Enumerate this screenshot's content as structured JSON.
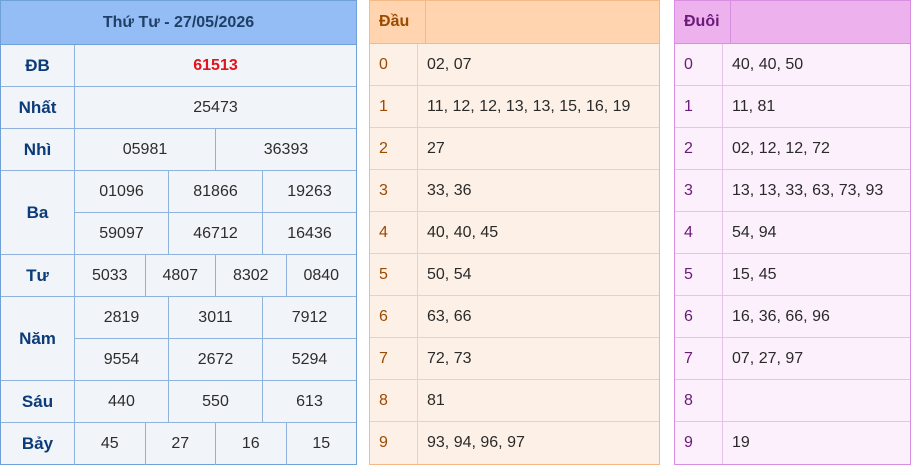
{
  "results": {
    "title": "Thứ Tư - 27/05/2026",
    "prizes": [
      {
        "name": "ĐB",
        "rows": [
          [
            "61513"
          ]
        ],
        "special": true
      },
      {
        "name": "Nhất",
        "rows": [
          [
            "25473"
          ]
        ]
      },
      {
        "name": "Nhì",
        "rows": [
          [
            "05981",
            "36393"
          ]
        ]
      },
      {
        "name": "Ba",
        "rows": [
          [
            "01096",
            "81866",
            "19263"
          ],
          [
            "59097",
            "46712",
            "16436"
          ]
        ]
      },
      {
        "name": "Tư",
        "rows": [
          [
            "5033",
            "4807",
            "8302",
            "0840"
          ]
        ]
      },
      {
        "name": "Năm",
        "rows": [
          [
            "2819",
            "3011",
            "7912"
          ],
          [
            "9554",
            "2672",
            "5294"
          ]
        ]
      },
      {
        "name": "Sáu",
        "rows": [
          [
            "440",
            "550",
            "613"
          ]
        ]
      },
      {
        "name": "Bảy",
        "rows": [
          [
            "45",
            "27",
            "16",
            "15"
          ]
        ]
      }
    ]
  },
  "dau": {
    "header": "Đầu",
    "rows": [
      {
        "key": "0",
        "value": "02, 07"
      },
      {
        "key": "1",
        "value": "11, 12, 12, 13, 13, 15, 16, 19"
      },
      {
        "key": "2",
        "value": "27"
      },
      {
        "key": "3",
        "value": "33, 36"
      },
      {
        "key": "4",
        "value": "40, 40, 45"
      },
      {
        "key": "5",
        "value": "50, 54"
      },
      {
        "key": "6",
        "value": "63, 66"
      },
      {
        "key": "7",
        "value": "72, 73"
      },
      {
        "key": "8",
        "value": "81"
      },
      {
        "key": "9",
        "value": "93, 94, 96, 97"
      }
    ]
  },
  "duoi": {
    "header": "Đuôi",
    "rows": [
      {
        "key": "0",
        "value": "40, 40, 50"
      },
      {
        "key": "1",
        "value": "11, 81"
      },
      {
        "key": "2",
        "value": "02, 12, 12, 72"
      },
      {
        "key": "3",
        "value": "13, 13, 33, 63, 73, 93"
      },
      {
        "key": "4",
        "value": "54, 94"
      },
      {
        "key": "5",
        "value": "15, 45"
      },
      {
        "key": "6",
        "value": "16, 36, 66, 96"
      },
      {
        "key": "7",
        "value": "07, 27, 97"
      },
      {
        "key": "8",
        "value": ""
      },
      {
        "key": "9",
        "value": "19"
      }
    ]
  },
  "colors": {
    "special_number": "#e0141c",
    "results_header": "#94bdf5",
    "dau_header": "#ffd4ae",
    "duoi_header": "#edb1ee"
  }
}
